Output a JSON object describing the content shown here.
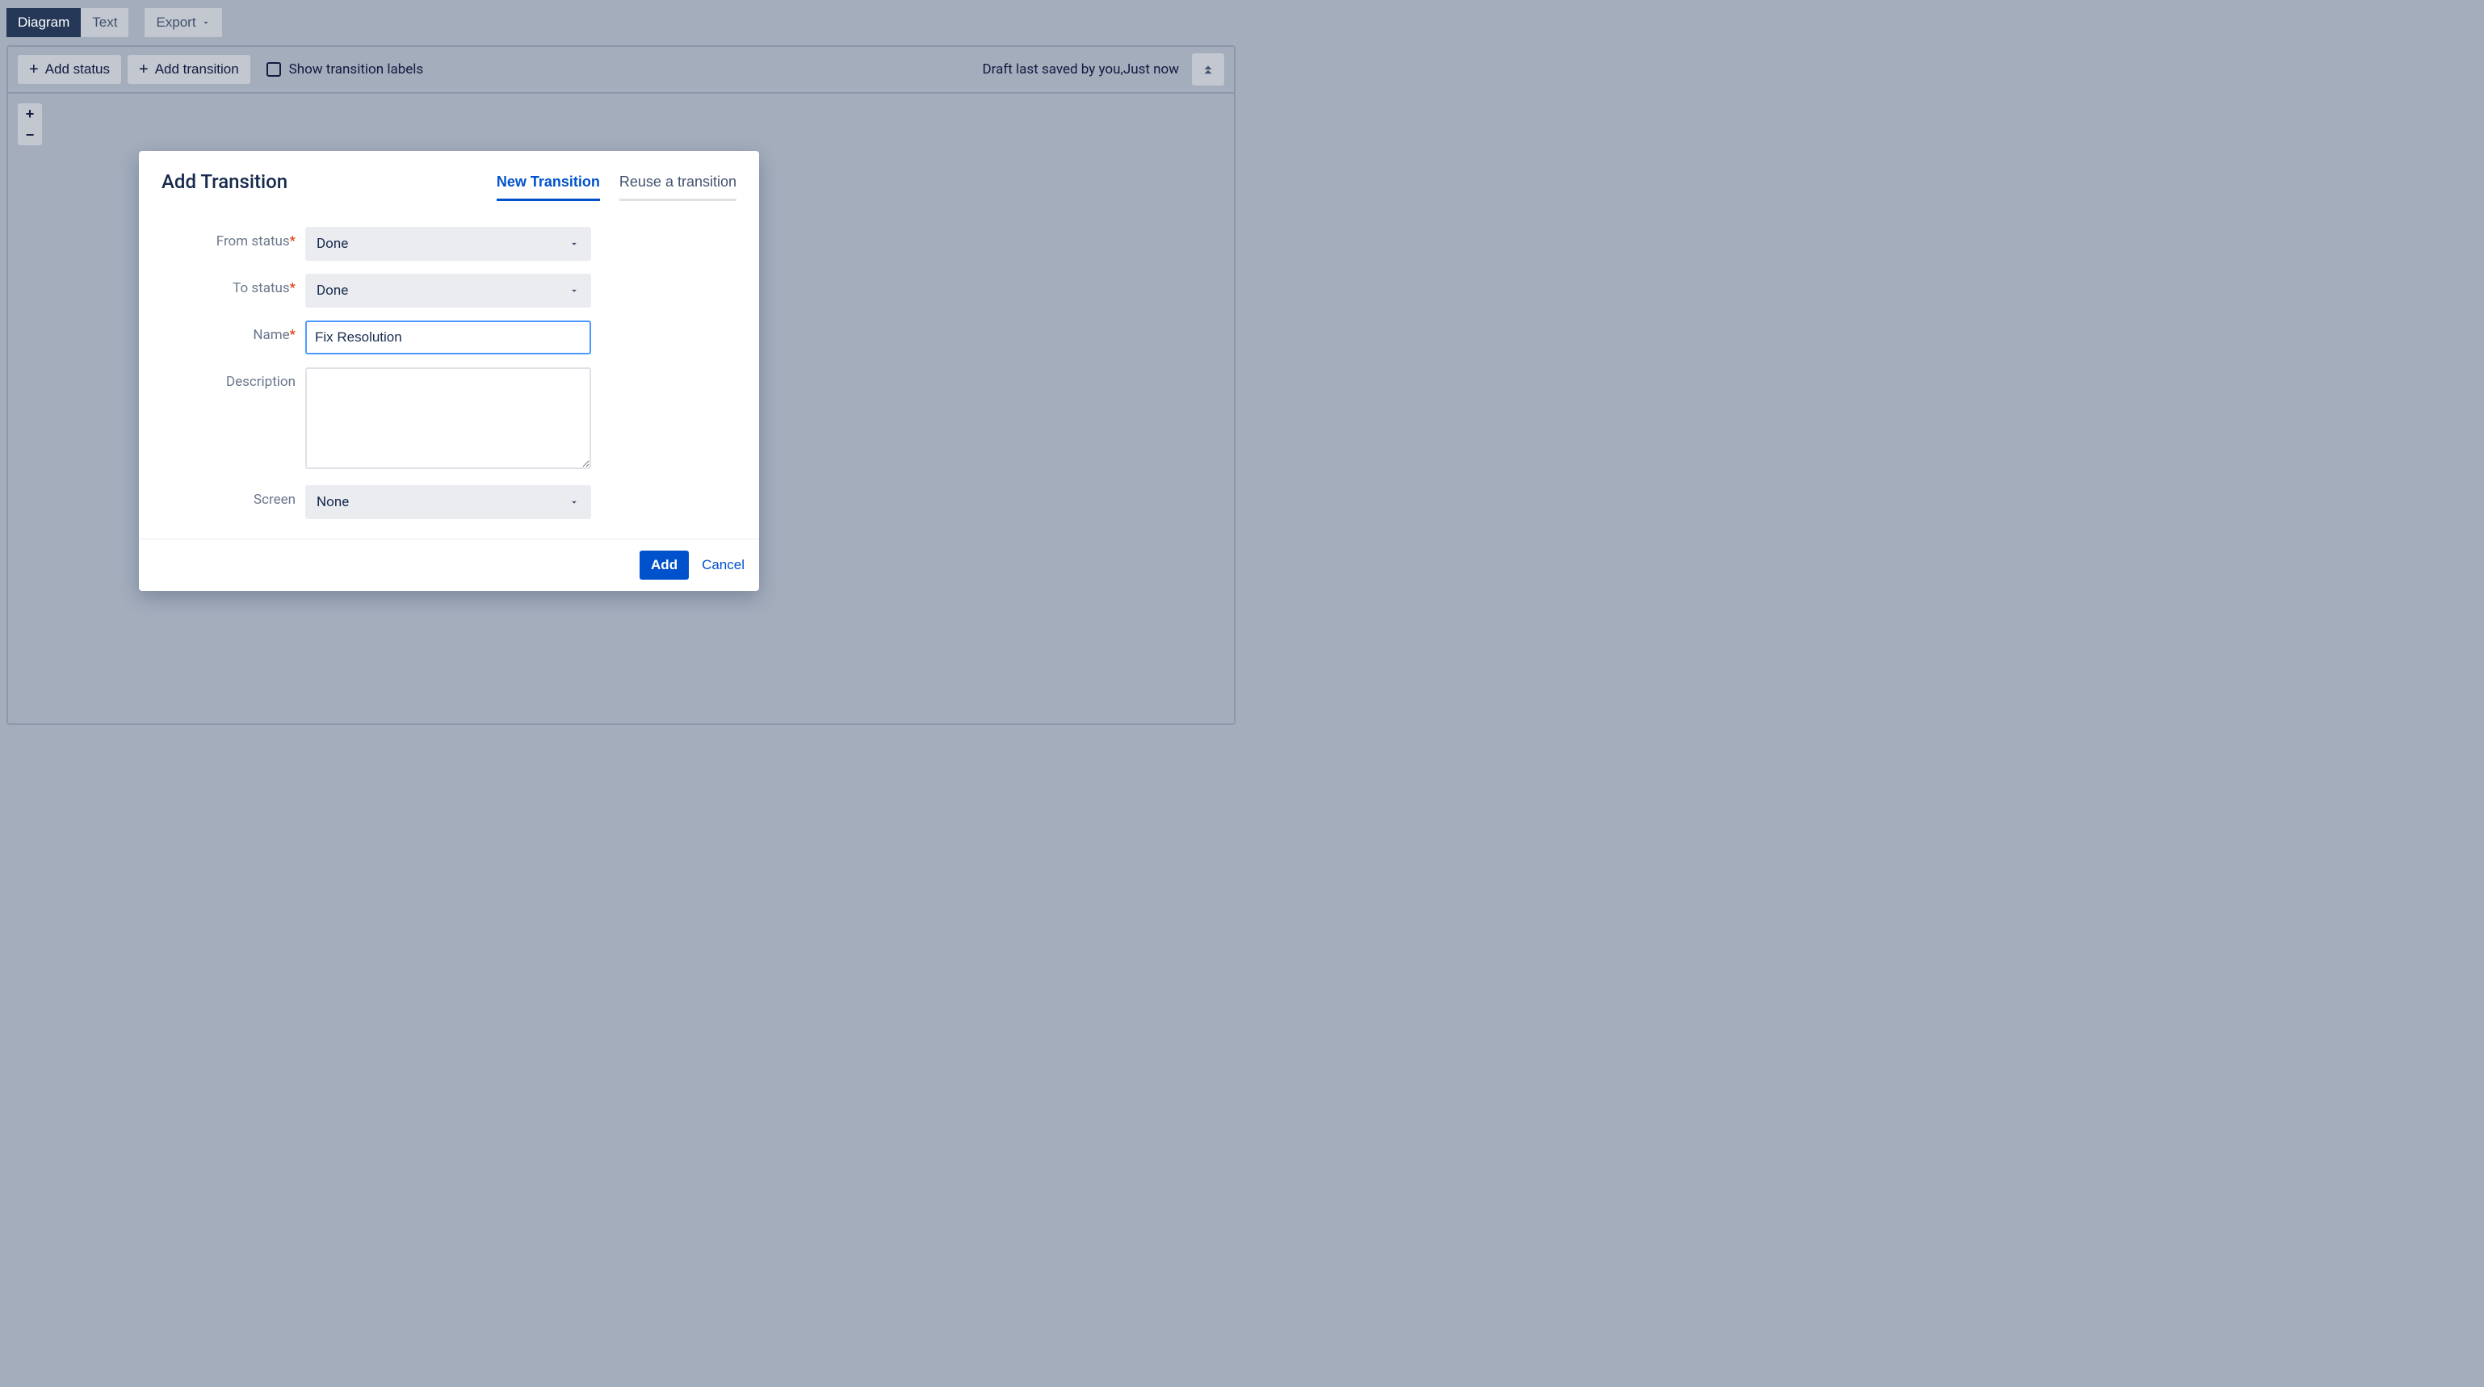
{
  "toolbar": {
    "tabs": [
      "Diagram",
      "Text"
    ],
    "active_tab": 0,
    "export_label": "Export"
  },
  "panel": {
    "add_status_label": "Add status",
    "add_transition_label": "Add transition",
    "show_labels_label": "Show transition labels",
    "save_status": "Draft last saved by you,Just now",
    "zoom_in": "+",
    "zoom_out": "−"
  },
  "modal": {
    "title": "Add Transition",
    "tabs": {
      "new": "New Transition",
      "reuse": "Reuse a transition"
    },
    "form": {
      "from_status": {
        "label": "From status",
        "value": "Done"
      },
      "to_status": {
        "label": "To status",
        "value": "Done"
      },
      "name": {
        "label": "Name",
        "value": "Fix Resolution"
      },
      "description": {
        "label": "Description",
        "value": ""
      },
      "screen": {
        "label": "Screen",
        "value": "None"
      }
    },
    "actions": {
      "add": "Add",
      "cancel": "Cancel"
    }
  }
}
